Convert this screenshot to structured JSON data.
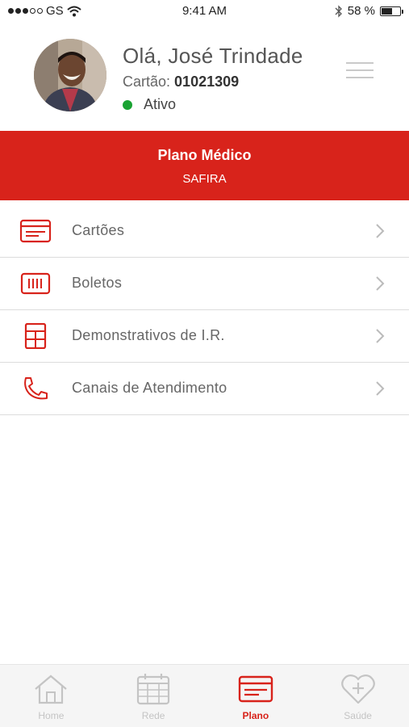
{
  "status_bar": {
    "carrier": "GS",
    "time": "9:41 AM",
    "battery_percent": "58 %",
    "battery_level": 0.58
  },
  "user": {
    "greeting": "Olá, José Trindade",
    "card_label": "Cartão:",
    "card_number": "01021309",
    "status": "Ativo",
    "status_color": "#1aa333"
  },
  "plan": {
    "title": "Plano Médico",
    "subtitle": "SAFIRA",
    "color": "#d8231b"
  },
  "menu": [
    {
      "label": "Cartões",
      "icon": "card-icon"
    },
    {
      "label": "Boletos",
      "icon": "barcode-icon"
    },
    {
      "label": "Demonstrativos de I.R.",
      "icon": "table-grid-icon"
    },
    {
      "label": "Canais de Atendimento",
      "icon": "phone-icon"
    }
  ],
  "tabs": [
    {
      "label": "Home",
      "icon": "home-icon",
      "active": false
    },
    {
      "label": "Rede",
      "icon": "calendar-icon",
      "active": false
    },
    {
      "label": "Plano",
      "icon": "card-icon",
      "active": true
    },
    {
      "label": "Saúde",
      "icon": "heart-plus-icon",
      "active": false
    }
  ],
  "colors": {
    "accent": "#d8231b",
    "inactive_tab": "#c4c4c4"
  }
}
